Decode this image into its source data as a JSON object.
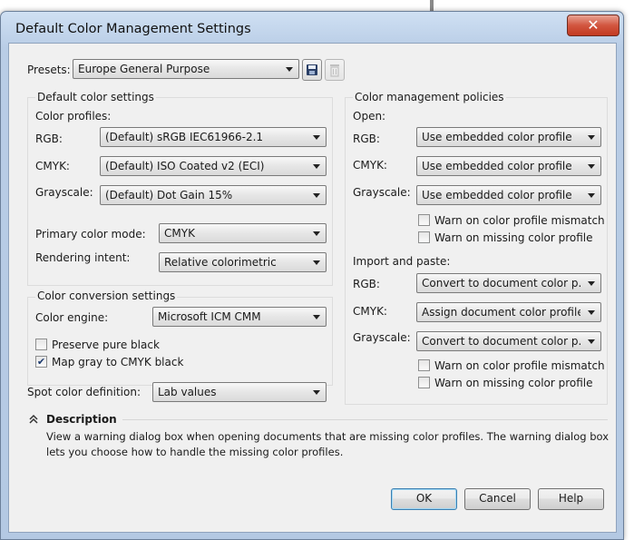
{
  "window": {
    "title": "Default Color Management Settings",
    "close_glyph": "✕"
  },
  "presets": {
    "label": "Presets:",
    "value": "Europe General Purpose",
    "save_icon": "save-icon",
    "delete_icon": "delete-icon"
  },
  "default_color": {
    "heading": "Default color settings",
    "profiles_label": "Color profiles:",
    "rgb_label": "RGB:",
    "rgb_value": "(Default) sRGB IEC61966-2.1",
    "cmyk_label": "CMYK:",
    "cmyk_value": "(Default) ISO Coated v2 (ECI)",
    "gray_label": "Grayscale:",
    "gray_value": "(Default) Dot Gain 15%",
    "primary_label": "Primary color mode:",
    "primary_value": "CMYK",
    "intent_label": "Rendering intent:",
    "intent_value": "Relative colorimetric"
  },
  "conversion": {
    "heading": "Color conversion settings",
    "engine_label": "Color engine:",
    "engine_value": "Microsoft ICM CMM",
    "preserve_black_label": "Preserve pure black",
    "preserve_black_checked": false,
    "map_gray_label": "Map gray to CMYK black",
    "map_gray_checked": true
  },
  "spot": {
    "label": "Spot color definition:",
    "value": "Lab values"
  },
  "policies": {
    "heading": "Color management policies",
    "open_label": "Open:",
    "rgb_label": "RGB:",
    "open_rgb": "Use embedded color profile",
    "cmyk_label": "CMYK:",
    "open_cmyk": "Use embedded color profile",
    "gray_label": "Grayscale:",
    "open_gray": "Use embedded color profile",
    "warn_mismatch": "Warn on color profile mismatch",
    "warn_missing": "Warn on missing color profile",
    "import_label": "Import and paste:",
    "import_rgb": "Convert to document color p...",
    "import_cmyk": "Assign document color profile",
    "import_gray": "Convert to document color p...",
    "import_warn_mismatch": "Warn on color profile mismatch",
    "import_warn_missing": "Warn on missing color profile"
  },
  "description": {
    "heading": "Description",
    "line1": "View a warning dialog box when opening documents that are missing color profiles. The warning dialog box",
    "line2": "lets you choose how to handle the missing color profiles."
  },
  "buttons": {
    "ok": "OK",
    "cancel": "Cancel",
    "help": "Help"
  }
}
